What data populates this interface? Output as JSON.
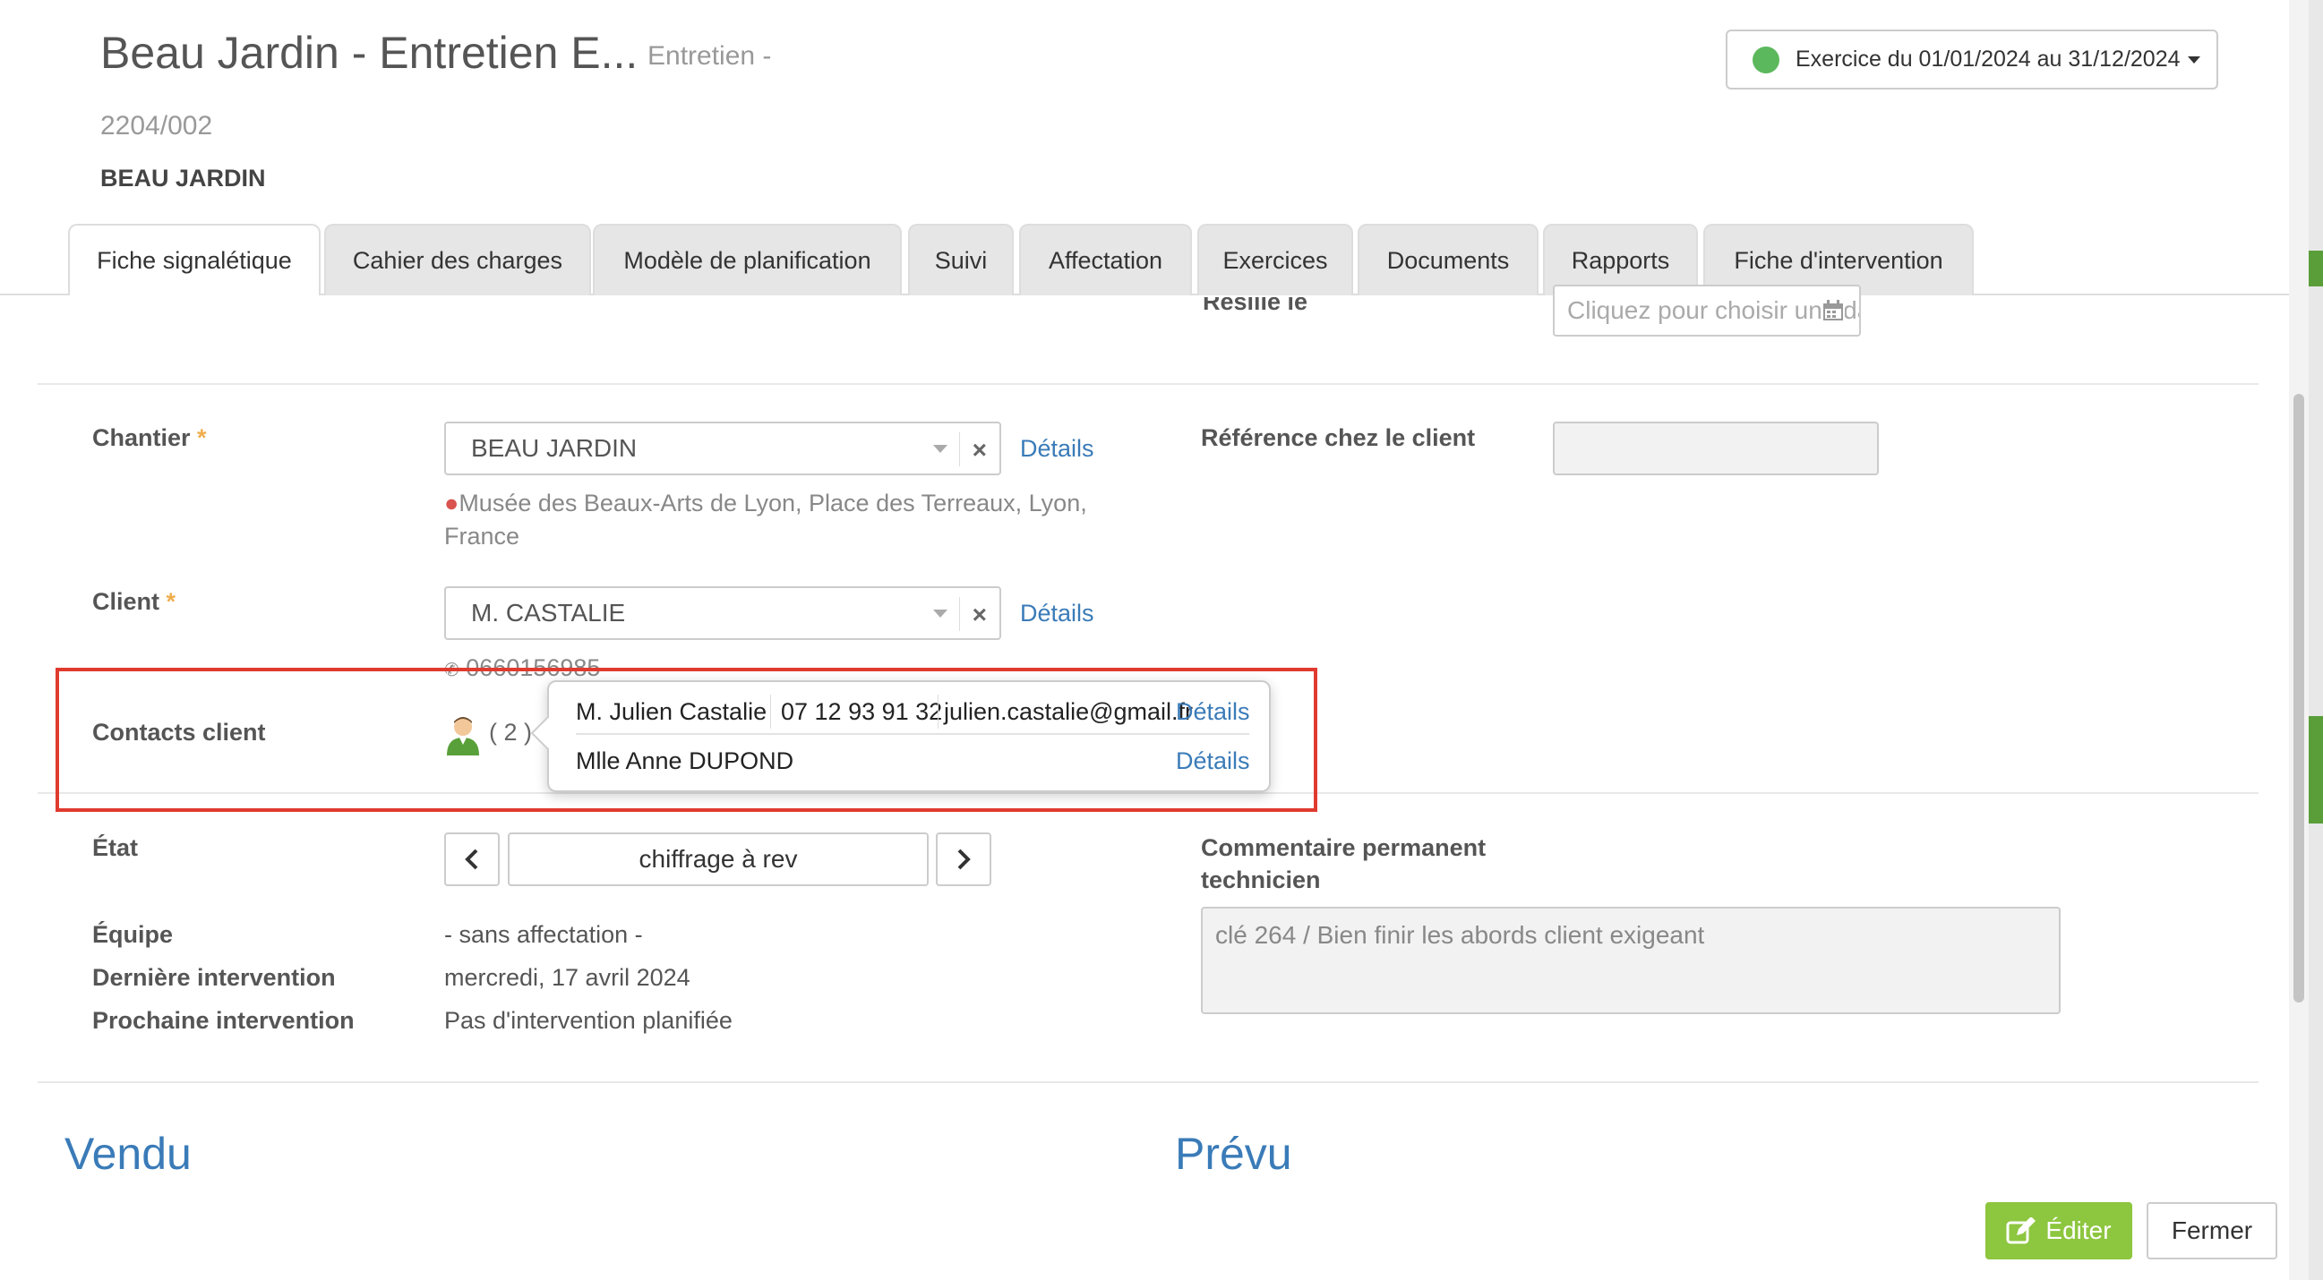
{
  "header": {
    "title": "Beau Jardin - Entretien E...",
    "subtitle": "Entretien -",
    "reference": "2204/002",
    "site_name": "BEAU JARDIN",
    "exercise_label": "Exercice du 01/01/2024 au 31/12/2024"
  },
  "tabs": [
    {
      "label": "Fiche signalétique",
      "active": true
    },
    {
      "label": "Cahier des charges"
    },
    {
      "label": "Modèle de planification"
    },
    {
      "label": "Suivi"
    },
    {
      "label": "Affectation"
    },
    {
      "label": "Exercices"
    },
    {
      "label": "Documents"
    },
    {
      "label": "Rapports"
    },
    {
      "label": "Fiche d'intervention"
    }
  ],
  "form": {
    "resilie_label": "Résilié le",
    "resilie_placeholder": "Cliquez pour choisir une date",
    "chantier_label": "Chantier",
    "chantier_value": "BEAU JARDIN",
    "chantier_address": "Musée des Beaux-Arts de Lyon, Place des Terreaux, Lyon,",
    "chantier_address_2": "France",
    "details_label": "Détails",
    "reference_client_label": "Référence chez le client",
    "reference_client_value": "",
    "client_label": "Client",
    "client_value": "M. CASTALIE",
    "client_phone": "0660156985",
    "contacts_label": "Contacts client",
    "contacts_count": "( 2 )",
    "etat_label": "État",
    "etat_value": "chiffrage à rev",
    "equipe_label": "Équipe",
    "equipe_value": "- sans affectation -",
    "derniere_label": "Dernière intervention",
    "derniere_value": "mercredi, 17 avril 2024",
    "prochaine_label": "Prochaine intervention",
    "prochaine_value": "Pas d'intervention planifiée",
    "commentaire_label_1": "Commentaire permanent",
    "commentaire_label_2": "technicien",
    "commentaire_value": "clé 264 / Bien finir les abords client exigeant",
    "required_mark": "*"
  },
  "contacts_popover": [
    {
      "name": "M. Julien Castalie",
      "phone": "07 12 93 91 32",
      "email": "julien.castalie@gmail.fr",
      "link": "Détails"
    },
    {
      "name": "Mlle Anne DUPOND",
      "phone": "",
      "email": "",
      "link": "Détails"
    }
  ],
  "sections": {
    "vendu": "Vendu",
    "prevu": "Prévu"
  },
  "footer": {
    "edit_label": "Éditer",
    "close_label": "Fermer"
  },
  "colors": {
    "accent_green": "#8dc63f",
    "link_blue": "#3a7bb8",
    "highlight_red": "#e03a2f",
    "status_green": "#5cb85c"
  }
}
